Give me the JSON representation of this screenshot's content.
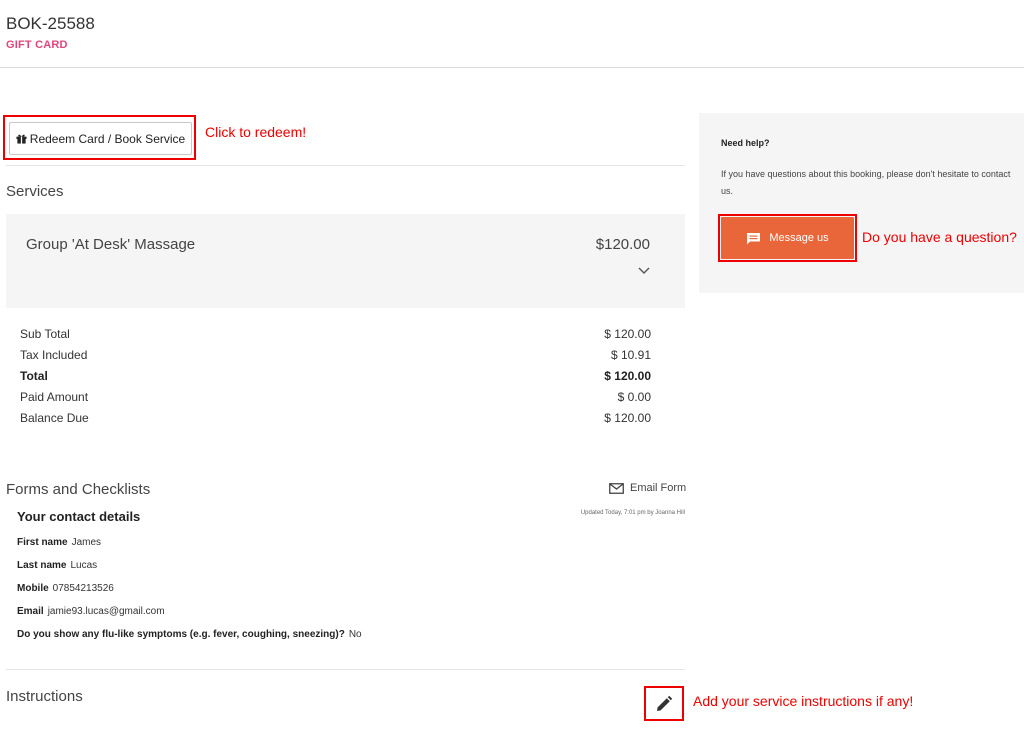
{
  "booking": {
    "id": "BOK-25588",
    "type": "GIFT CARD"
  },
  "actions": {
    "redeem_label": "Redeem Card / Book Service"
  },
  "annotations": {
    "redeem": "Click to redeem!",
    "message": "Do you have a question?",
    "instructions": "Add your service instructions if any!"
  },
  "services": {
    "title": "Services",
    "items": [
      {
        "name": "Group 'At Desk' Massage",
        "price": "$120.00"
      }
    ]
  },
  "totals": [
    {
      "label": "Sub Total",
      "value": "$ 120.00"
    },
    {
      "label": "Tax Included",
      "value": "$ 10.91"
    },
    {
      "label": "Total",
      "value": "$ 120.00"
    },
    {
      "label": "Paid Amount",
      "value": "$ 0.00"
    },
    {
      "label": "Balance Due",
      "value": "$ 120.00"
    }
  ],
  "forms": {
    "title": "Forms and Checklists",
    "email_label": "Email Form",
    "updated": "Updated Today, 7:01 pm by Joanna Hill",
    "contact_title": "Your contact details",
    "fields": [
      {
        "label": "First name",
        "value": "James"
      },
      {
        "label": "Last name",
        "value": "Lucas"
      },
      {
        "label": "Mobile",
        "value": "07854213526"
      },
      {
        "label": "Email",
        "value": "jamie93.lucas@gmail.com"
      },
      {
        "label": "Do you show any flu-like symptoms (e.g. fever, coughing, sneezing)?",
        "value": "No"
      }
    ]
  },
  "instructions": {
    "title": "Instructions"
  },
  "help": {
    "title": "Need help?",
    "text": "If you have questions about this booking, please don't hesitate to contact us.",
    "button": "Message us"
  },
  "colors": {
    "accent": "#e8663a",
    "brand_pink": "#e0457b",
    "annotation_red": "#ee0000"
  },
  "icons": {
    "gift": "gift-icon",
    "chevron": "chevron-down-icon",
    "mail": "mail-icon",
    "message": "message-icon",
    "pencil": "pencil-icon"
  }
}
